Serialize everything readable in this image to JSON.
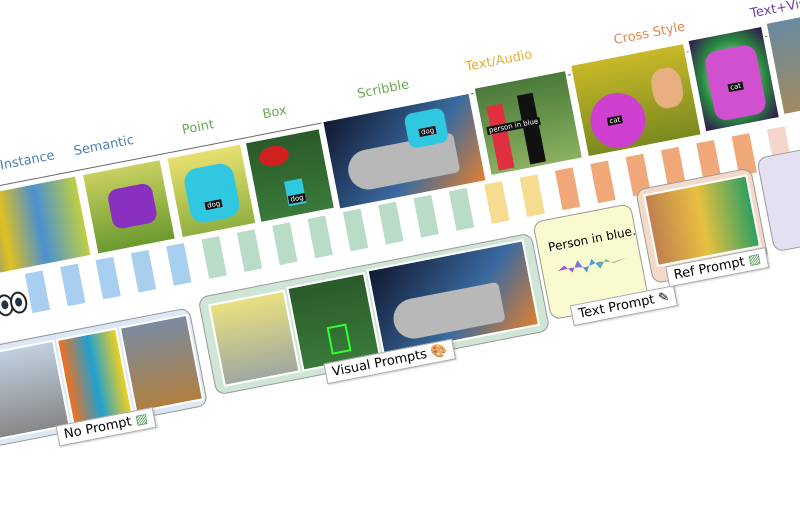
{
  "categories": [
    {
      "label": "Instance",
      "color": "#4a7fb5"
    },
    {
      "label": "Semantic",
      "color": "#4a7fb5"
    },
    {
      "label": "Point",
      "color": "#6aa84f"
    },
    {
      "label": "Box",
      "color": "#6aa84f"
    },
    {
      "label": "Scribble",
      "color": "#6aa84f"
    },
    {
      "label": "Text/Audio",
      "color": "#e0b030"
    },
    {
      "label": "Cross Style",
      "color": "#e08850"
    },
    {
      "label": "Text+Vis",
      "color": "#6a3fa0"
    }
  ],
  "image_tags": {
    "dog1": "dog",
    "dog2": "dog",
    "dog3": "dog",
    "person": "person in blue",
    "cat1": "cat",
    "cat2": "cat"
  },
  "prompts": {
    "no_prompt": "No Prompt",
    "visual_prompts": "Visual Prompts",
    "text_prompt": "Text Prompt",
    "text_example": "Person in blue.",
    "ref_prompt": "Ref Prompt"
  },
  "colors": {
    "blue": "#a8cff0",
    "green": "#b8dcc8",
    "yellow": "#f5dc90",
    "orange": "#f0a878",
    "pink": "#f5d5cc"
  }
}
